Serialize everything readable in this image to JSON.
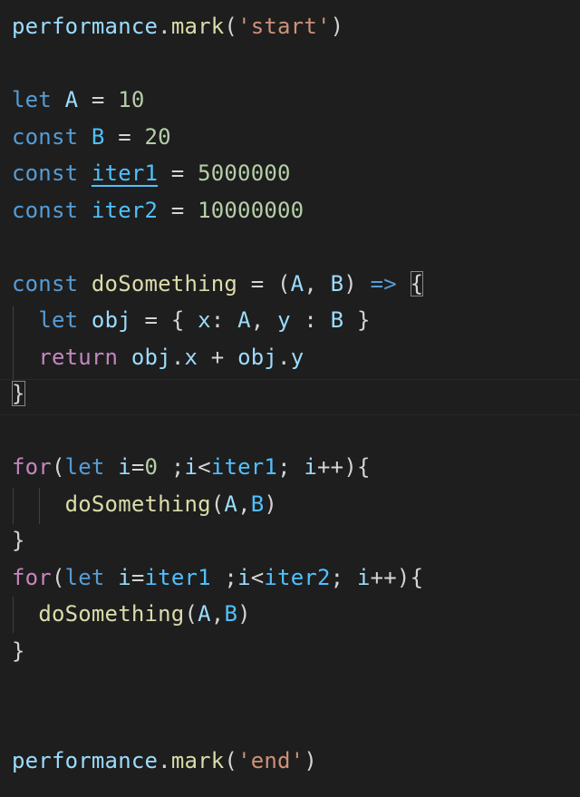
{
  "editor": {
    "colors": {
      "background": "#1e1e1e",
      "keyword": "#569cd6",
      "function": "#dcdcaa",
      "string": "#ce9178",
      "number": "#b5cea8",
      "control": "#c586c0",
      "variable": "#9cdcfe",
      "constant": "#4fc1ff",
      "plain": "#d4d4d4"
    },
    "lines": [
      [
        {
          "text": "performance",
          "kind": "lblue"
        },
        {
          "text": ".",
          "kind": "plain"
        },
        {
          "text": "mark",
          "kind": "yellow"
        },
        {
          "text": "(",
          "kind": "plain"
        },
        {
          "text": "'start'",
          "kind": "orange"
        },
        {
          "text": ")",
          "kind": "plain"
        }
      ],
      [],
      [
        {
          "text": "let",
          "kind": "blue"
        },
        {
          "text": " ",
          "kind": "plain"
        },
        {
          "text": "A",
          "kind": "lblue"
        },
        {
          "text": " = ",
          "kind": "plain"
        },
        {
          "text": "10",
          "kind": "num"
        }
      ],
      [
        {
          "text": "const",
          "kind": "blue"
        },
        {
          "text": " ",
          "kind": "plain"
        },
        {
          "text": "B",
          "kind": "cyan"
        },
        {
          "text": " = ",
          "kind": "plain"
        },
        {
          "text": "20",
          "kind": "num"
        }
      ],
      [
        {
          "text": "const",
          "kind": "blue"
        },
        {
          "text": " ",
          "kind": "plain"
        },
        {
          "text": "iter1",
          "kind": "cyan",
          "underline": true
        },
        {
          "text": " = ",
          "kind": "plain"
        },
        {
          "text": "5000000",
          "kind": "num"
        }
      ],
      [
        {
          "text": "const",
          "kind": "blue"
        },
        {
          "text": " ",
          "kind": "plain"
        },
        {
          "text": "iter2",
          "kind": "cyan"
        },
        {
          "text": " = ",
          "kind": "plain"
        },
        {
          "text": "10000000",
          "kind": "num"
        }
      ],
      [],
      [
        {
          "text": "const",
          "kind": "blue"
        },
        {
          "text": " ",
          "kind": "plain"
        },
        {
          "text": "doSomething",
          "kind": "yellow"
        },
        {
          "text": " = (",
          "kind": "plain"
        },
        {
          "text": "A",
          "kind": "lblue"
        },
        {
          "text": ", ",
          "kind": "plain"
        },
        {
          "text": "B",
          "kind": "lblue"
        },
        {
          "text": ") ",
          "kind": "plain"
        },
        {
          "text": "=>",
          "kind": "blue"
        },
        {
          "text": " ",
          "kind": "plain"
        },
        {
          "text": "{",
          "kind": "plain",
          "boxed": true
        }
      ],
      [
        {
          "text": "  ",
          "kind": "plain"
        },
        {
          "text": "let",
          "kind": "blue"
        },
        {
          "text": " ",
          "kind": "plain"
        },
        {
          "text": "obj",
          "kind": "lblue"
        },
        {
          "text": " = { ",
          "kind": "plain"
        },
        {
          "text": "x",
          "kind": "lblue"
        },
        {
          "text": ": ",
          "kind": "plain"
        },
        {
          "text": "A",
          "kind": "lblue"
        },
        {
          "text": ", ",
          "kind": "plain"
        },
        {
          "text": "y",
          "kind": "lblue"
        },
        {
          "text": " : ",
          "kind": "plain"
        },
        {
          "text": "B",
          "kind": "lblue"
        },
        {
          "text": " }",
          "kind": "plain"
        }
      ],
      [
        {
          "text": "  ",
          "kind": "plain"
        },
        {
          "text": "return",
          "kind": "purple"
        },
        {
          "text": " ",
          "kind": "plain"
        },
        {
          "text": "obj",
          "kind": "lblue"
        },
        {
          "text": ".",
          "kind": "plain"
        },
        {
          "text": "x",
          "kind": "lblue"
        },
        {
          "text": " + ",
          "kind": "plain"
        },
        {
          "text": "obj",
          "kind": "lblue"
        },
        {
          "text": ".",
          "kind": "plain"
        },
        {
          "text": "y",
          "kind": "lblue"
        }
      ],
      [
        {
          "text": "}",
          "kind": "plain",
          "boxed": true
        }
      ],
      [],
      [
        {
          "text": "for",
          "kind": "purple"
        },
        {
          "text": "(",
          "kind": "plain"
        },
        {
          "text": "let",
          "kind": "blue"
        },
        {
          "text": " ",
          "kind": "plain"
        },
        {
          "text": "i",
          "kind": "lblue"
        },
        {
          "text": "=",
          "kind": "plain"
        },
        {
          "text": "0",
          "kind": "num"
        },
        {
          "text": " ;",
          "kind": "plain"
        },
        {
          "text": "i",
          "kind": "lblue"
        },
        {
          "text": "<",
          "kind": "plain"
        },
        {
          "text": "iter1",
          "kind": "cyan"
        },
        {
          "text": "; ",
          "kind": "plain"
        },
        {
          "text": "i",
          "kind": "lblue"
        },
        {
          "text": "++){",
          "kind": "plain"
        }
      ],
      [
        {
          "text": "    ",
          "kind": "plain"
        },
        {
          "text": "doSomething",
          "kind": "yellow"
        },
        {
          "text": "(",
          "kind": "plain"
        },
        {
          "text": "A",
          "kind": "lblue"
        },
        {
          "text": ",",
          "kind": "plain"
        },
        {
          "text": "B",
          "kind": "cyan"
        },
        {
          "text": ")",
          "kind": "plain"
        }
      ],
      [
        {
          "text": "}",
          "kind": "plain"
        }
      ],
      [
        {
          "text": "for",
          "kind": "purple"
        },
        {
          "text": "(",
          "kind": "plain"
        },
        {
          "text": "let",
          "kind": "blue"
        },
        {
          "text": " ",
          "kind": "plain"
        },
        {
          "text": "i",
          "kind": "lblue"
        },
        {
          "text": "=",
          "kind": "plain"
        },
        {
          "text": "iter1",
          "kind": "cyan"
        },
        {
          "text": " ;",
          "kind": "plain"
        },
        {
          "text": "i",
          "kind": "lblue"
        },
        {
          "text": "<",
          "kind": "plain"
        },
        {
          "text": "iter2",
          "kind": "cyan"
        },
        {
          "text": "; ",
          "kind": "plain"
        },
        {
          "text": "i",
          "kind": "lblue"
        },
        {
          "text": "++){",
          "kind": "plain"
        }
      ],
      [
        {
          "text": "  ",
          "kind": "plain"
        },
        {
          "text": "doSomething",
          "kind": "yellow"
        },
        {
          "text": "(",
          "kind": "plain"
        },
        {
          "text": "A",
          "kind": "lblue"
        },
        {
          "text": ",",
          "kind": "plain"
        },
        {
          "text": "B",
          "kind": "cyan"
        },
        {
          "text": ")",
          "kind": "plain"
        }
      ],
      [
        {
          "text": "}",
          "kind": "plain"
        }
      ],
      [],
      [],
      [
        {
          "text": "performance",
          "kind": "lblue"
        },
        {
          "text": ".",
          "kind": "plain"
        },
        {
          "text": "mark",
          "kind": "yellow"
        },
        {
          "text": "(",
          "kind": "plain"
        },
        {
          "text": "'end'",
          "kind": "orange"
        },
        {
          "text": ")",
          "kind": "plain"
        }
      ]
    ]
  }
}
